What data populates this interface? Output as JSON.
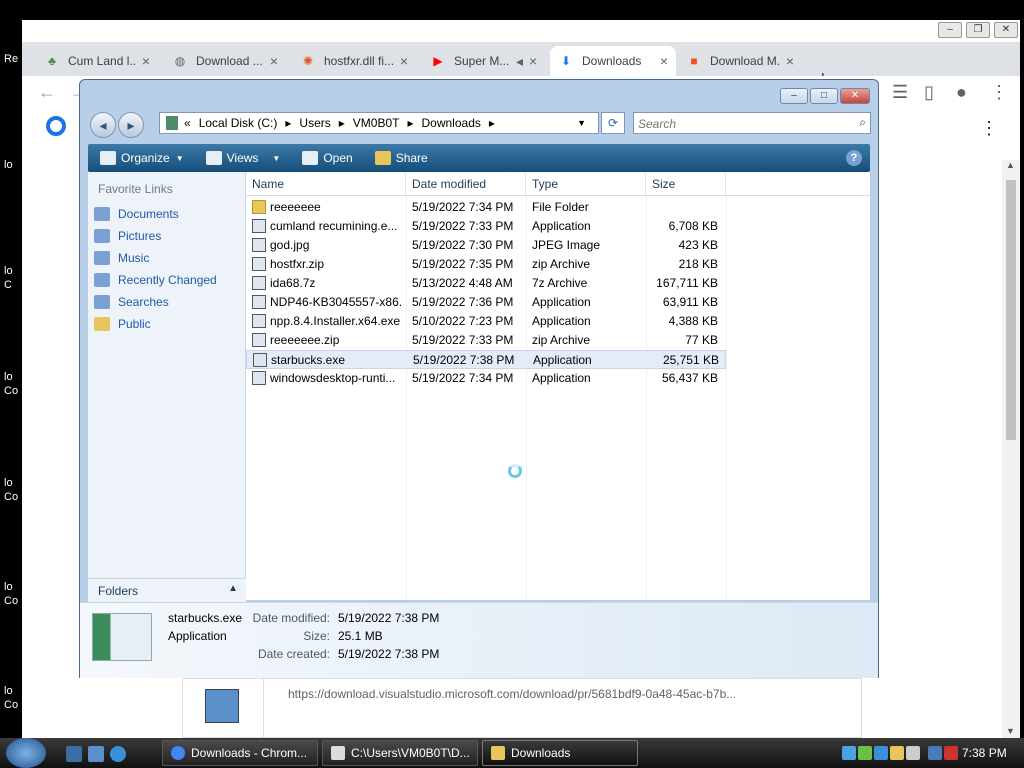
{
  "desktop": {
    "icons": [
      {
        "label": "Re"
      },
      {
        "label": "lo"
      },
      {
        "label": "lo\nC"
      },
      {
        "label": "lo\nCo"
      },
      {
        "label": "lo\nCo"
      },
      {
        "label": "lo\nCo"
      },
      {
        "label": "lo\nCo"
      }
    ]
  },
  "chrome": {
    "tabs": [
      {
        "title": "Cum Land l...",
        "icon": "cumland-icon"
      },
      {
        "title": "Download ...",
        "icon": "globe-icon"
      },
      {
        "title": "hostfxr.dll fi...",
        "icon": "gear-icon"
      },
      {
        "title": "Super M...",
        "icon": "youtube-icon"
      },
      {
        "title": "Downloads",
        "icon": "download-icon",
        "active": true
      },
      {
        "title": "Download M...",
        "icon": "windows-icon"
      }
    ],
    "new_tab": "+",
    "url": "https://download.visualstudio.microsoft.com/download/pr/5681bdf9-0a48-45ac-b7b..."
  },
  "explorer": {
    "breadcrumb": [
      "Local Disk (C:)",
      "Users",
      "VM0B0T",
      "Downloads"
    ],
    "search_placeholder": "Search",
    "commands": [
      "Organize",
      "Views",
      "Open",
      "Share"
    ],
    "favorite_links_header": "Favorite Links",
    "favorite_links": [
      "Documents",
      "Pictures",
      "Music",
      "Recently Changed",
      "Searches",
      "Public"
    ],
    "folders_label": "Folders",
    "columns": [
      "Name",
      "Date modified",
      "Type",
      "Size"
    ],
    "files": [
      {
        "name": "reeeeeee",
        "date": "5/19/2022 7:34 PM",
        "type": "File Folder",
        "size": "",
        "icon": "folder"
      },
      {
        "name": "cumland recumining.e...",
        "date": "5/19/2022 7:33 PM",
        "type": "Application",
        "size": "6,708 KB",
        "icon": "app"
      },
      {
        "name": "god.jpg",
        "date": "5/19/2022 7:30 PM",
        "type": "JPEG Image",
        "size": "423 KB",
        "icon": "image"
      },
      {
        "name": "hostfxr.zip",
        "date": "5/19/2022 7:35 PM",
        "type": "zip Archive",
        "size": "218 KB",
        "icon": "zip"
      },
      {
        "name": "ida68.7z",
        "date": "5/13/2022 4:48 AM",
        "type": "7z Archive",
        "size": "167,711 KB",
        "icon": "zip"
      },
      {
        "name": "NDP46-KB3045557-x86...",
        "date": "5/19/2022 7:36 PM",
        "type": "Application",
        "size": "63,911 KB",
        "icon": "app"
      },
      {
        "name": "npp.8.4.Installer.x64.exe",
        "date": "5/10/2022 7:23 PM",
        "type": "Application",
        "size": "4,388 KB",
        "icon": "app"
      },
      {
        "name": "reeeeeee.zip",
        "date": "5/19/2022 7:33 PM",
        "type": "zip Archive",
        "size": "77 KB",
        "icon": "zip"
      },
      {
        "name": "starbucks.exe",
        "date": "5/19/2022 7:38 PM",
        "type": "Application",
        "size": "25,751 KB",
        "icon": "app",
        "selected": true
      },
      {
        "name": "windowsdesktop-runti...",
        "date": "5/19/2022 7:34 PM",
        "type": "Application",
        "size": "56,437 KB",
        "icon": "app"
      }
    ],
    "details": {
      "name": "starbucks.exe",
      "type": "Application",
      "date_modified_label": "Date modified:",
      "date_modified": "5/19/2022 7:38 PM",
      "size_label": "Size:",
      "size": "25.1 MB",
      "date_created_label": "Date created:",
      "date_created": "5/19/2022 7:38 PM"
    }
  },
  "taskbar": {
    "buttons": [
      {
        "label": "Downloads - Chrom..."
      },
      {
        "label": "C:\\Users\\VM0B0T\\D..."
      },
      {
        "label": "Downloads",
        "active": true
      }
    ],
    "clock": "7:38 PM"
  }
}
